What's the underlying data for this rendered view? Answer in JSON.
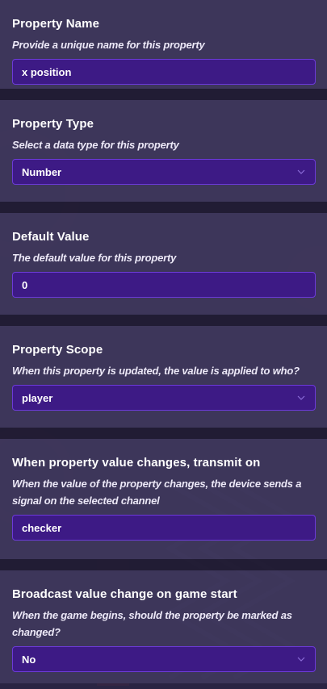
{
  "sections": [
    {
      "title": "Property Name",
      "description": "Provide a unique name for this property",
      "control": "text",
      "value": "x position"
    },
    {
      "title": "Property Type",
      "description": "Select a data type for this property",
      "control": "select",
      "value": "Number"
    },
    {
      "title": "Default Value",
      "description": "The default value for this property",
      "control": "text",
      "value": "0"
    },
    {
      "title": "Property Scope",
      "description": "When this property is updated, the value is applied to who?",
      "control": "select",
      "value": "player"
    },
    {
      "title": "When property value changes, transmit on",
      "description": "When the value of the property changes, the device sends a signal on the selected channel",
      "control": "text",
      "value": "checker"
    },
    {
      "title": "Broadcast value change on game start",
      "description": "When the game begins, should the property be marked as changed?",
      "control": "select",
      "value": "No"
    }
  ],
  "icons": {
    "dropdown": "chevron-down-icon"
  },
  "colors": {
    "section_bg": "#3e385c",
    "divider_bg": "#211c34",
    "field_bg": "#3d1a85",
    "field_border": "#6c3ad8",
    "chevron": "#8b6cd9"
  }
}
